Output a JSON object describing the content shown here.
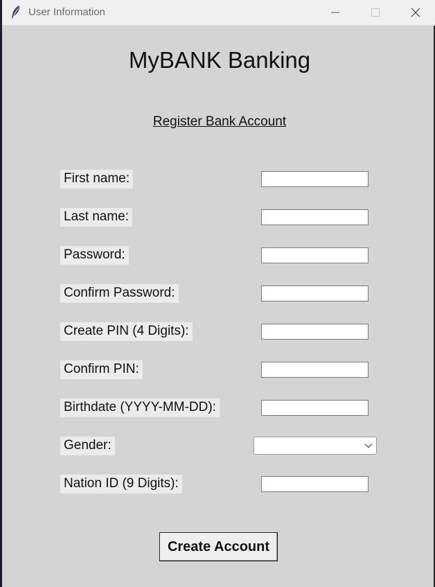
{
  "window": {
    "title": "User Information"
  },
  "app": {
    "heading": "MyBANK Banking",
    "subheading": "Register Bank Account"
  },
  "form": {
    "fields": [
      {
        "label": "First name:",
        "value": ""
      },
      {
        "label": "Last name:",
        "value": ""
      },
      {
        "label": "Password:",
        "value": ""
      },
      {
        "label": "Confirm Password:",
        "value": ""
      },
      {
        "label": "Create PIN (4 Digits):",
        "value": ""
      },
      {
        "label": "Confirm PIN:",
        "value": ""
      },
      {
        "label": "Birthdate (YYYY-MM-DD):",
        "value": ""
      }
    ],
    "gender": {
      "label": "Gender:",
      "selected": ""
    },
    "nation_id": {
      "label": "Nation ID (9 Digits):",
      "value": ""
    },
    "submit_label": "Create Account"
  },
  "icons": {
    "app": "feather-icon",
    "minimize": "minimize-icon",
    "maximize": "maximize-icon",
    "close": "close-icon",
    "dropdown": "chevron-down-icon"
  }
}
